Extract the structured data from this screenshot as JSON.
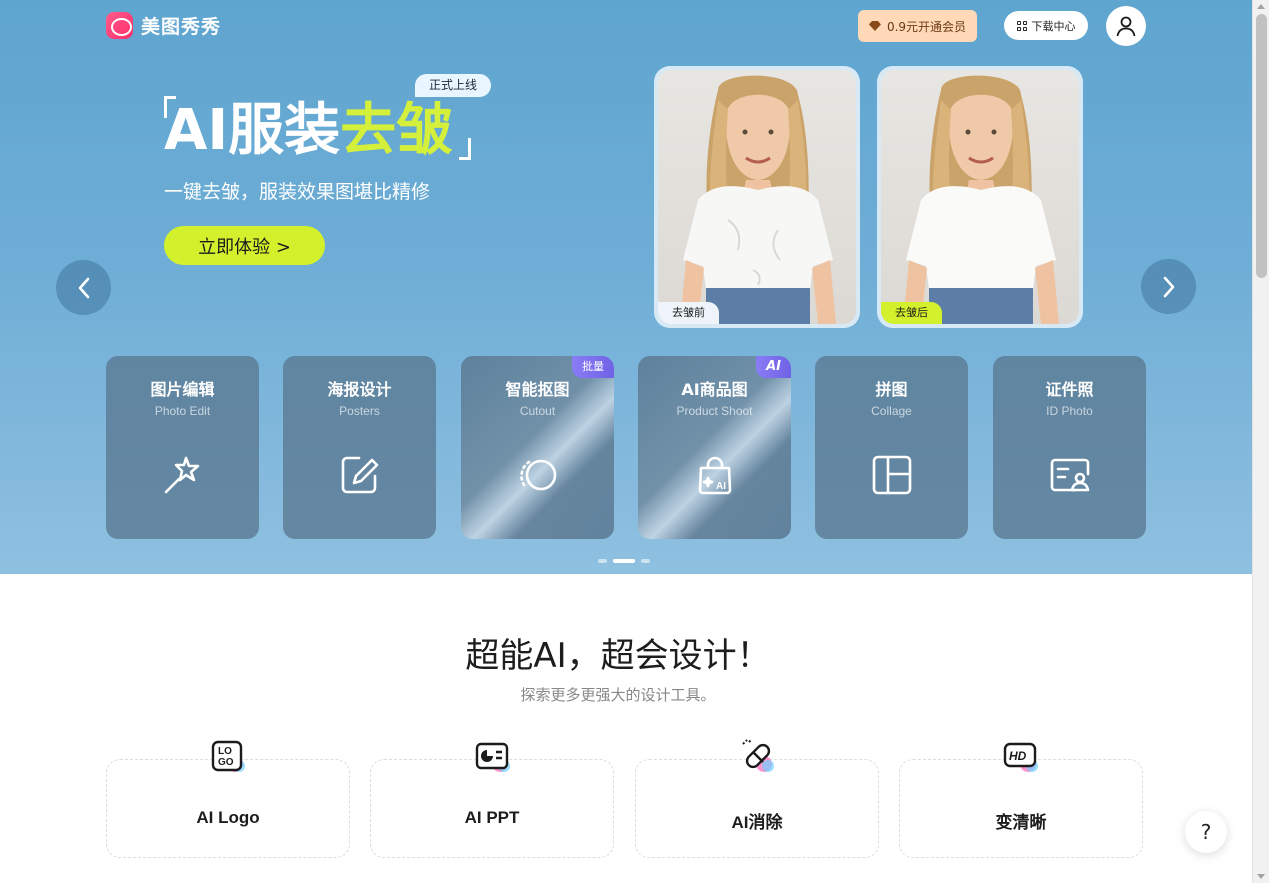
{
  "header": {
    "logo_text": "美图秀秀",
    "vip_label": "0.9元开通会员",
    "download_label": "下载中心"
  },
  "hero": {
    "tag": "正式上线",
    "title_main": "AI服装",
    "title_highlight": "去皱",
    "subtitle": "一键去皱，服装效果图堪比精修",
    "cta": "立即体验 >",
    "before_label": "去皱前",
    "after_label": "去皱后"
  },
  "features": [
    {
      "title": "图片编辑",
      "en": "Photo Edit",
      "icon": "magic-wand-icon"
    },
    {
      "title": "海报设计",
      "en": "Posters",
      "icon": "edit-square-icon"
    },
    {
      "title": "智能抠图",
      "en": "Cutout",
      "icon": "cutout-circle-icon",
      "badge": "批量"
    },
    {
      "title": "AI商品图",
      "en": "Product Shoot",
      "icon": "shopping-bag-ai-icon",
      "badge": "AI"
    },
    {
      "title": "拼图",
      "en": "Collage",
      "icon": "collage-layout-icon"
    },
    {
      "title": "证件照",
      "en": "ID Photo",
      "icon": "id-card-icon"
    }
  ],
  "carousel": {
    "total": 3,
    "active": 2
  },
  "section": {
    "title": "超能AI，超会设计！",
    "subtitle": "探索更多更强大的设计工具。"
  },
  "tools": [
    {
      "name": "AI Logo",
      "icon": "logo-icon"
    },
    {
      "name": "AI PPT",
      "icon": "ppt-icon"
    },
    {
      "name": "AI消除",
      "icon": "eraser-icon"
    },
    {
      "name": "变清晰",
      "icon": "hd-icon"
    }
  ],
  "help": {
    "label": "?"
  },
  "colors": {
    "accent_lime": "#d3f02c",
    "hero_blue": "#6eadd6",
    "badge_purple": "#7b6ef0"
  }
}
